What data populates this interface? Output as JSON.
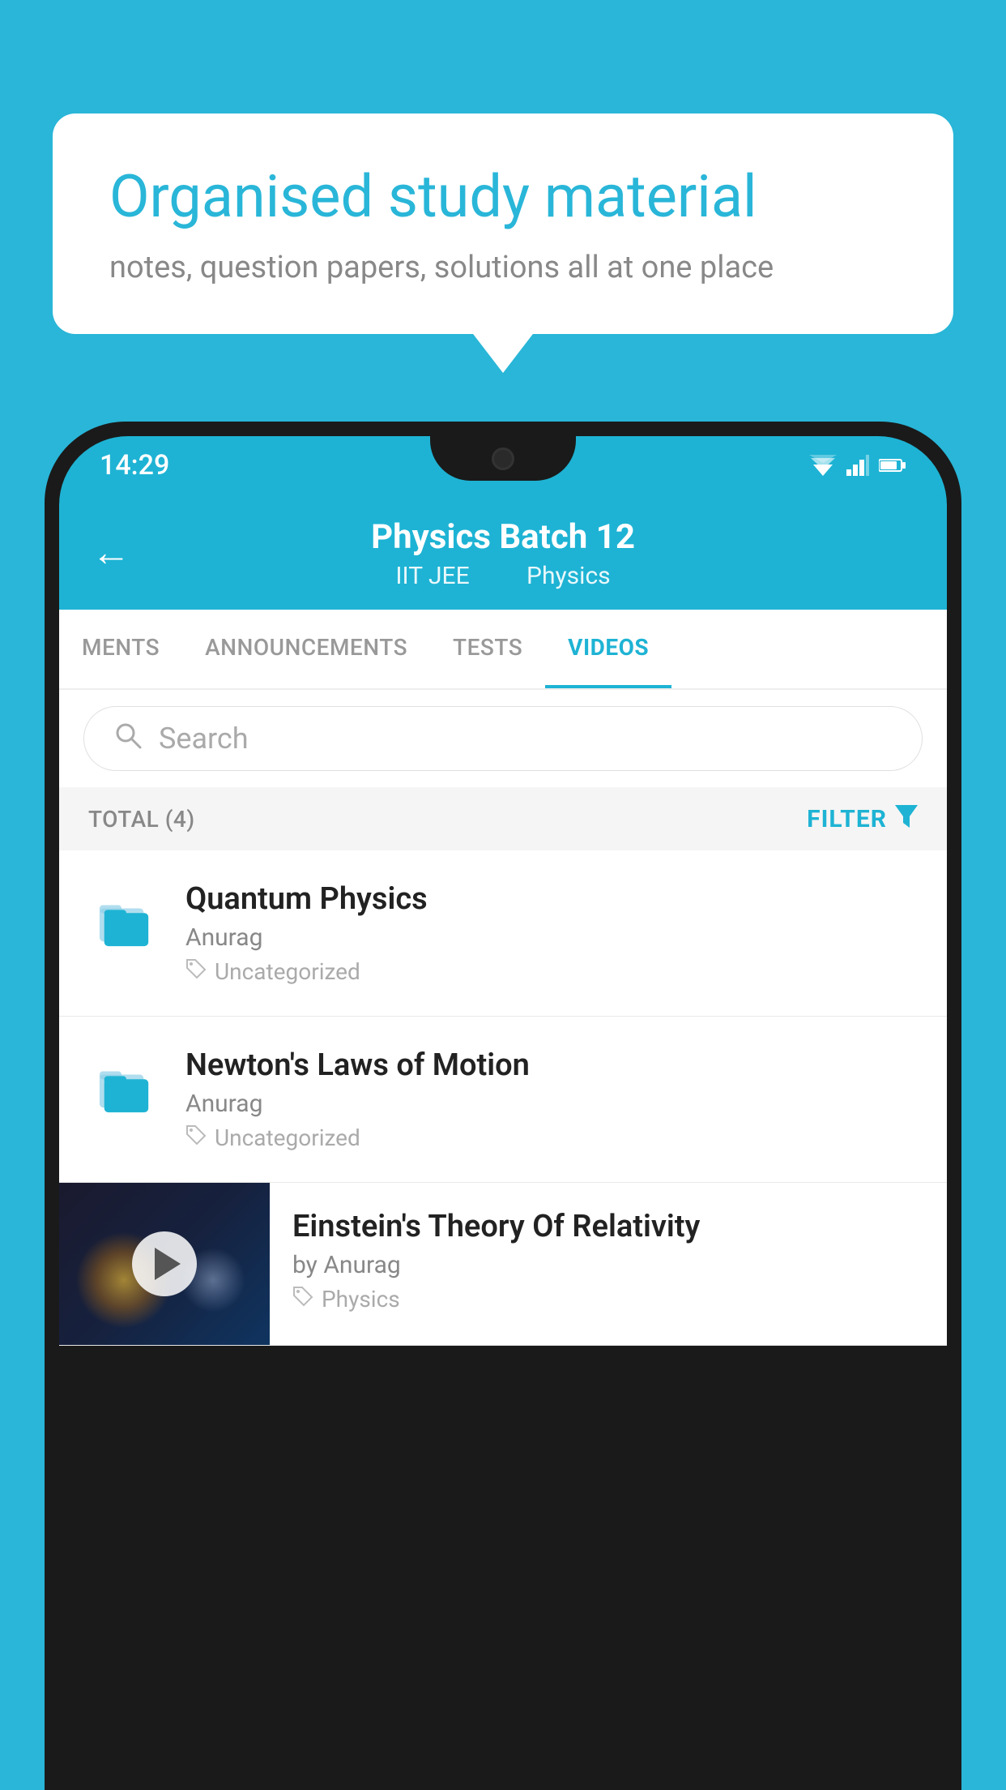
{
  "background": {
    "color": "#29b6d8"
  },
  "speech_bubble": {
    "title": "Organised study material",
    "subtitle": "notes, question papers, solutions all at one place"
  },
  "status_bar": {
    "time": "14:29"
  },
  "app_header": {
    "title": "Physics Batch 12",
    "subtitle_part1": "IIT JEE",
    "subtitle_part2": "Physics",
    "back_label": "←"
  },
  "tabs": [
    {
      "label": "MENTS",
      "active": false
    },
    {
      "label": "ANNOUNCEMENTS",
      "active": false
    },
    {
      "label": "TESTS",
      "active": false
    },
    {
      "label": "VIDEOS",
      "active": true
    }
  ],
  "search": {
    "placeholder": "Search"
  },
  "filter_row": {
    "total_label": "TOTAL (4)",
    "filter_label": "FILTER"
  },
  "list_items": [
    {
      "title": "Quantum Physics",
      "author": "Anurag",
      "tag": "Uncategorized",
      "type": "folder"
    },
    {
      "title": "Newton's Laws of Motion",
      "author": "Anurag",
      "tag": "Uncategorized",
      "type": "folder"
    },
    {
      "title": "Einstein's Theory Of Relativity",
      "author": "by Anurag",
      "tag": "Physics",
      "type": "video"
    }
  ]
}
